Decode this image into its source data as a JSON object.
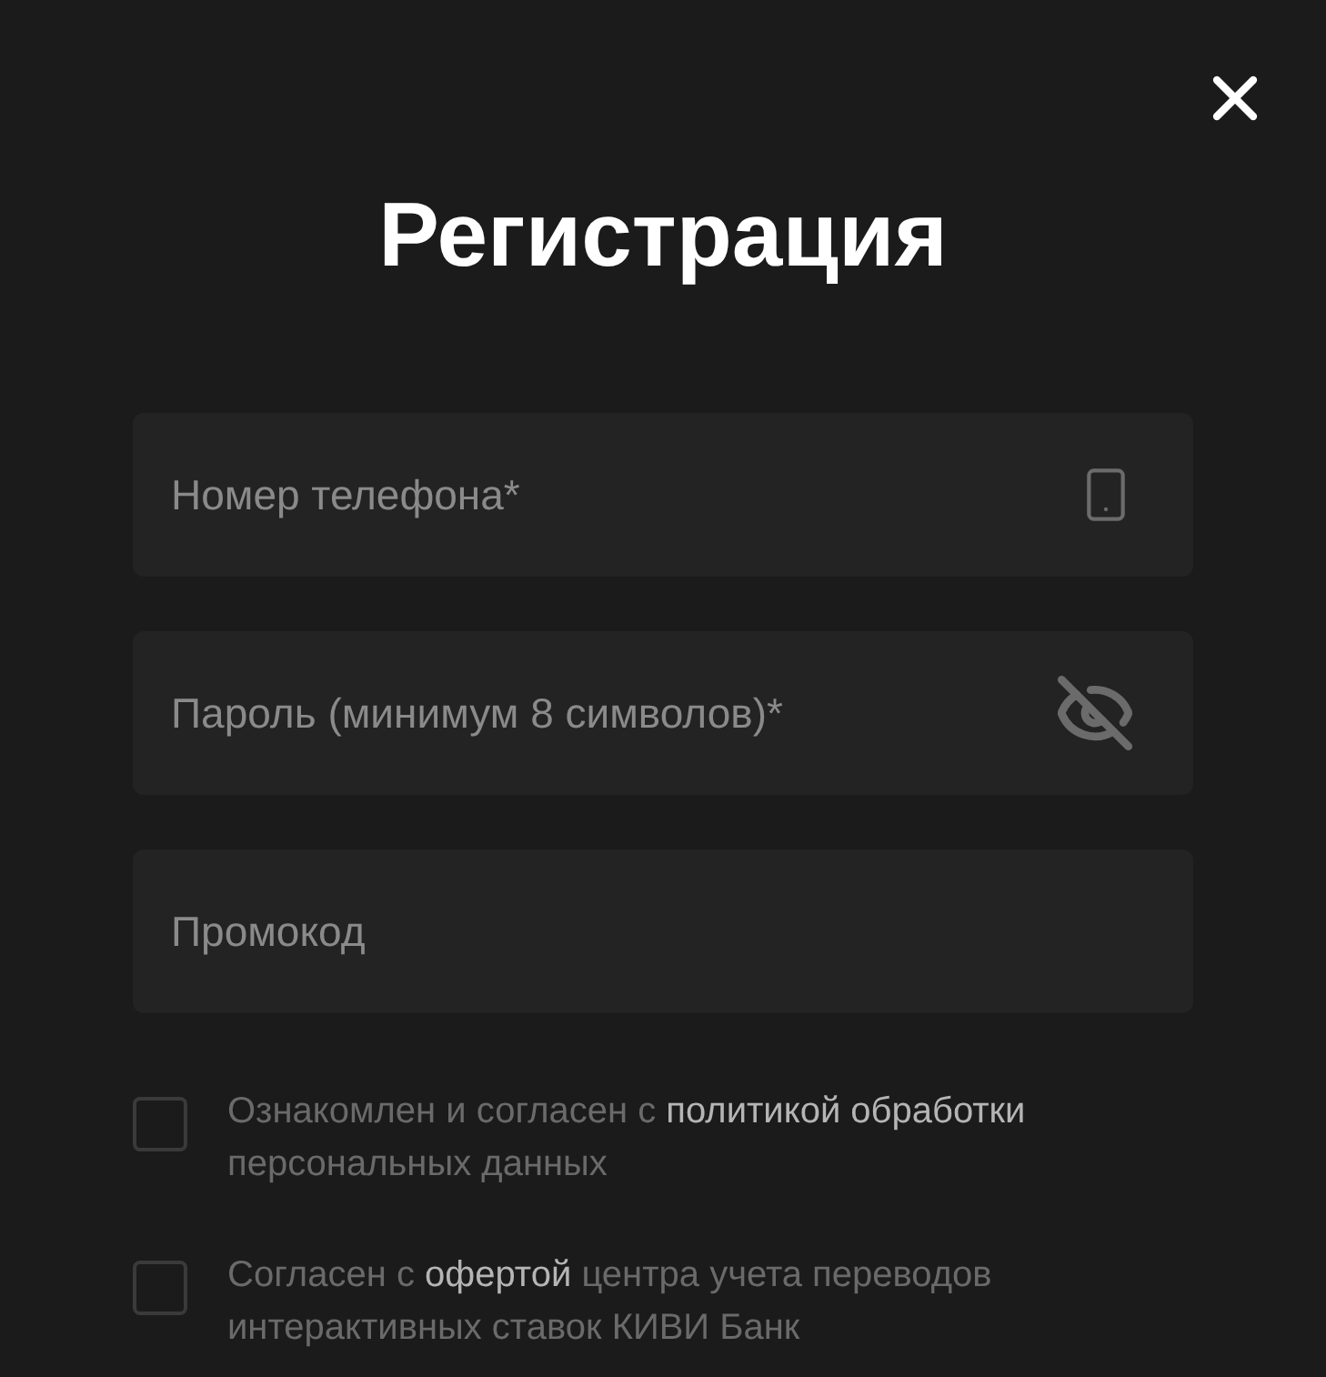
{
  "title": "Регистрация",
  "fields": [
    {
      "kind": "phone",
      "placeholder": "Номер телефона*"
    },
    {
      "kind": "password",
      "placeholder": "Пароль (минимум 8 символов)*"
    },
    {
      "kind": "text",
      "placeholder": "Промокод"
    }
  ],
  "agreements": [
    {
      "checked": false,
      "parts": [
        {
          "kind": "plain",
          "text": "Ознакомлен и согласен с"
        },
        {
          "kind": "link",
          "text": "политикой обработки"
        },
        {
          "kind": "plain",
          "text": "персональных данных"
        }
      ]
    },
    {
      "checked": false,
      "parts": [
        {
          "kind": "plain",
          "text": "Согласен с"
        },
        {
          "kind": "link",
          "text": "офертой"
        },
        {
          "kind": "plain",
          "text": "центра учета переводов интерактивных ставок КИВИ Банк"
        }
      ]
    }
  ]
}
